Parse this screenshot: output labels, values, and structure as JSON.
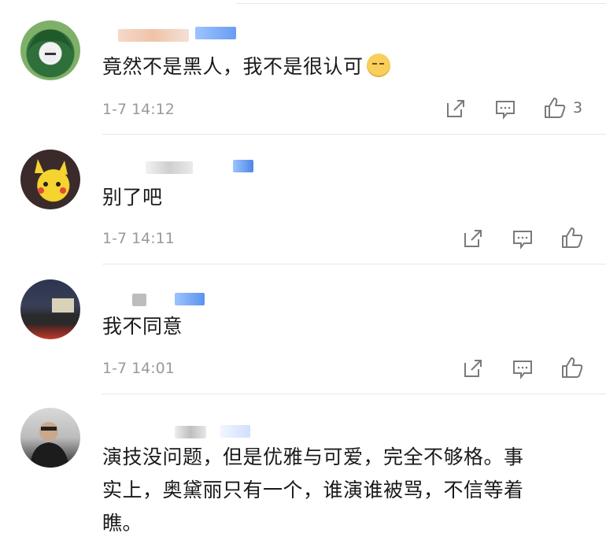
{
  "comments": [
    {
      "text": "竟然不是黑人，我不是很认可",
      "emoji": "dizzy-face-emoji",
      "time": "1-7 14:12",
      "likes": "3"
    },
    {
      "text": "别了吧",
      "time": "1-7 14:11",
      "likes": ""
    },
    {
      "text": "我不同意",
      "time": "1-7 14:01",
      "likes": ""
    },
    {
      "text_lines": [
        "演技没问题，但是优雅与可爱，完全不够格。事",
        "实上，奥黛丽只有一个，谁演谁被骂，不信等着",
        "瞧。"
      ]
    }
  ],
  "colors": {
    "text": "#1a1a1a",
    "meta": "#9a9a9a",
    "icon": "#7a7a7a",
    "badge": "#6a9cf2"
  },
  "icons": [
    "share-icon",
    "comment-icon",
    "like-icon"
  ]
}
